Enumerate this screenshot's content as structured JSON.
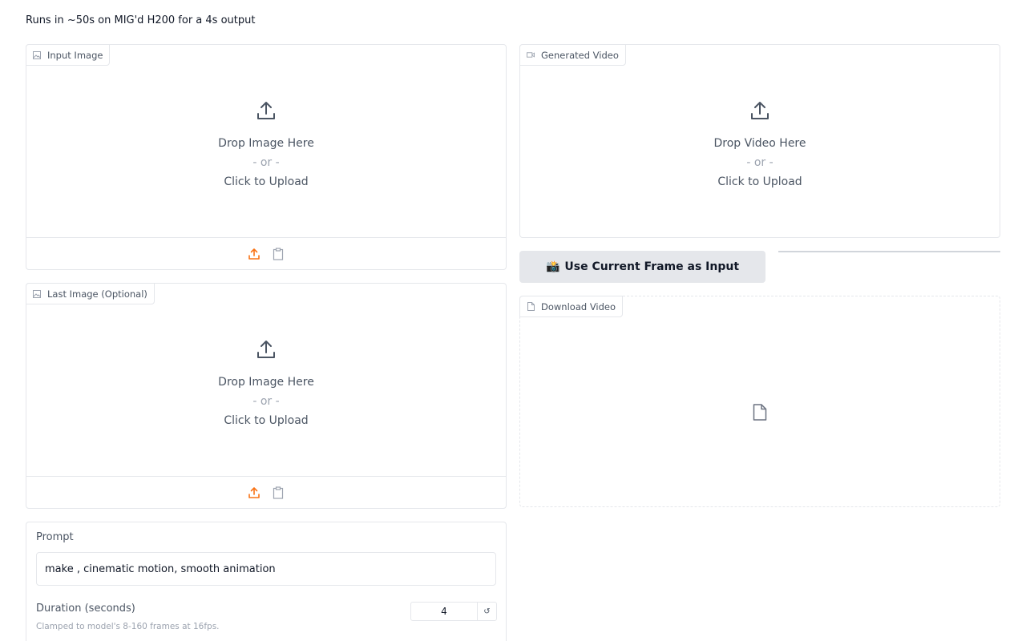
{
  "header": {
    "note": "Runs in ~50s on MIG'd H200 for a 4s output"
  },
  "input_image": {
    "label": "Input Image",
    "drop_text": "Drop Image Here",
    "or_text": "- or -",
    "click_text": "Click to Upload"
  },
  "last_image": {
    "label": "Last Image (Optional)",
    "drop_text": "Drop Image Here",
    "or_text": "- or -",
    "click_text": "Click to Upload"
  },
  "generated_video": {
    "label": "Generated Video",
    "drop_text": "Drop Video Here",
    "or_text": "- or -",
    "click_text": "Click to Upload"
  },
  "use_frame_button": {
    "emoji": "📸",
    "label": "Use Current Frame as Input"
  },
  "download_video": {
    "label": "Download Video"
  },
  "prompt": {
    "label": "Prompt",
    "value": "make , cinematic motion, smooth animation"
  },
  "duration": {
    "label": "Duration (seconds)",
    "info": "Clamped to model's 8-160 frames at 16fps.",
    "value": "4",
    "reset_glyph": "↺"
  },
  "colors": {
    "accent": "#f97316",
    "muted": "#9ca3af",
    "button_bg": "#e5e7eb"
  },
  "icons": {
    "label_image": "image-icon",
    "label_video": "video-camera-icon",
    "label_file": "file-icon",
    "upload": "upload-icon",
    "clipboard": "clipboard-icon"
  }
}
